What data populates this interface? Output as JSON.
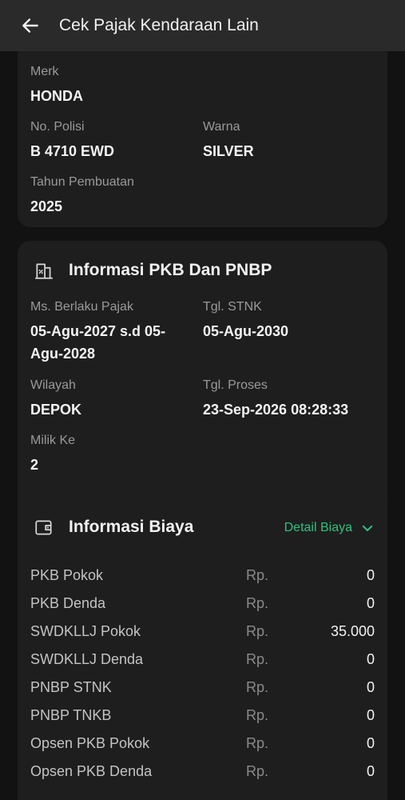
{
  "appbar": {
    "title": "Cek Pajak Kendaraan Lain"
  },
  "vehicle": {
    "merk_label": "Merk",
    "merk_value": "HONDA",
    "nopol_label": "No. Polisi",
    "nopol_value": "B 4710 EWD",
    "warna_label": "Warna",
    "warna_value": "SILVER",
    "tahun_label": "Tahun Pembuatan",
    "tahun_value": "2025"
  },
  "pkb": {
    "title": "Informasi PKB Dan PNBP",
    "berlaku_label": "Ms. Berlaku Pajak",
    "berlaku_value_1": "05-Agu-2027 s.d 05-",
    "berlaku_value_2": "Agu-2028",
    "stnk_label": "Tgl. STNK",
    "stnk_value": "05-Agu-2030",
    "wilayah_label": "Wilayah",
    "wilayah_value": "DEPOK",
    "proses_label": "Tgl. Proses",
    "proses_value": "23-Sep-2026 08:28:33",
    "milik_label": "Milik Ke",
    "milik_value": "2"
  },
  "biaya": {
    "title": "Informasi Biaya",
    "detail_label": "Detail Biaya",
    "accent_color": "#2ec27e",
    "rows": [
      {
        "name": "PKB Pokok",
        "currency": "Rp.",
        "amount": "0"
      },
      {
        "name": "PKB Denda",
        "currency": "Rp.",
        "amount": "0"
      },
      {
        "name": "SWDKLLJ Pokok",
        "currency": "Rp.",
        "amount": "35.000"
      },
      {
        "name": "SWDKLLJ Denda",
        "currency": "Rp.",
        "amount": "0"
      },
      {
        "name": "PNBP STNK",
        "currency": "Rp.",
        "amount": "0"
      },
      {
        "name": "PNBP TNKB",
        "currency": "Rp.",
        "amount": "0"
      },
      {
        "name": "Opsen PKB Pokok",
        "currency": "Rp.",
        "amount": "0"
      },
      {
        "name": "Opsen PKB Denda",
        "currency": "Rp.",
        "amount": "0"
      }
    ]
  }
}
